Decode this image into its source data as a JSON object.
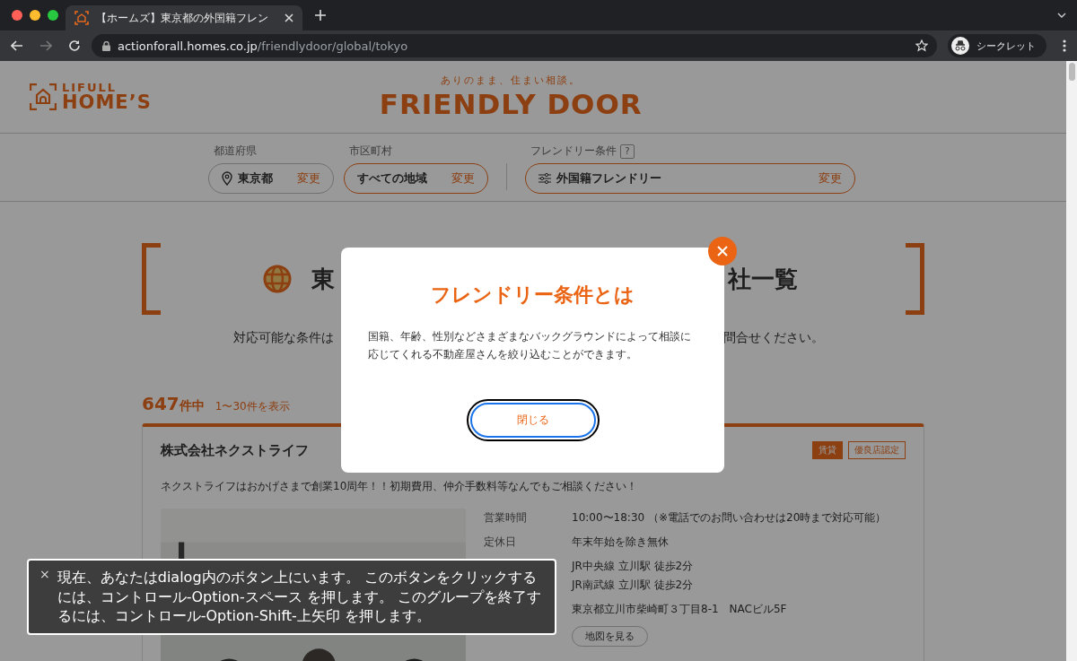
{
  "browser": {
    "tab_title": "【ホームズ】東京都の外国籍フレン",
    "url_host": "actionforall.homes.co.jp",
    "url_path": "/friendlydoor/global/tokyo",
    "profile_label": "シークレット",
    "forward_disabled": true
  },
  "header": {
    "logo_top": "LIFULL",
    "logo_bottom": "HOME’S",
    "tagline": "ありのまま、住まい相談。",
    "brand": "FRIENDLY DOOR"
  },
  "filters": [
    {
      "label": "都道府県",
      "value": "東京都",
      "action": "変更",
      "kind": "location",
      "active": false
    },
    {
      "label": "市区町村",
      "value": "すべての地域",
      "action": "変更",
      "kind": "plain",
      "active": true
    },
    {
      "label": "フレンドリー条件",
      "help": "?",
      "value": "外国籍フレンドリー",
      "action": "変更",
      "kind": "conditions",
      "active": true
    }
  ],
  "heading": {
    "title_start": "東",
    "title_end": "社一覧",
    "subtitle_start": "対応可能な条件は",
    "subtitle_end": "問合せください。"
  },
  "results": {
    "count": "647",
    "count_suffix": "件中",
    "range": "1〜30件を表示"
  },
  "card": {
    "title": "株式会社ネクストライフ",
    "tags": [
      {
        "label": "賃貸",
        "kind": "filled"
      },
      {
        "label": "優良店認定",
        "kind": "outline"
      }
    ],
    "description": "ネクストライフはおかげさまで創業10周年！！初期費用、仲介手数料等なんでもご相談ください！",
    "info": [
      {
        "label": "営業時間",
        "values": [
          "10:00〜18:30 （※電話でのお問い合わせは20時まで対応可能）"
        ]
      },
      {
        "label": "定休日",
        "values": [
          "年末年始を除き無休"
        ]
      },
      {
        "values": [
          "JR中央線 立川駅 徒歩2分",
          "JR南武線 立川駅 徒歩2分"
        ]
      },
      {
        "values": [
          "東京都立川市柴崎町３丁目8-1　NACビル5F"
        ]
      }
    ],
    "map_button": "地図を見る"
  },
  "dialog": {
    "title": "フレンドリー条件とは",
    "body": "国籍、年齢、性別などさまざまなバックグラウンドによって相談に応じてくれる不動産屋さんを絞り込むことができます。",
    "close_button": "閉じる",
    "focused": true
  },
  "voiceover": {
    "close": "×",
    "text": "現在、あなたはdialog内のボタン上にいます。 このボタンをクリックするには、コントロール-Option-スペース を押します。 このグループを終了するには、コントロール-Option-Shift-上矢印 を押します。"
  }
}
